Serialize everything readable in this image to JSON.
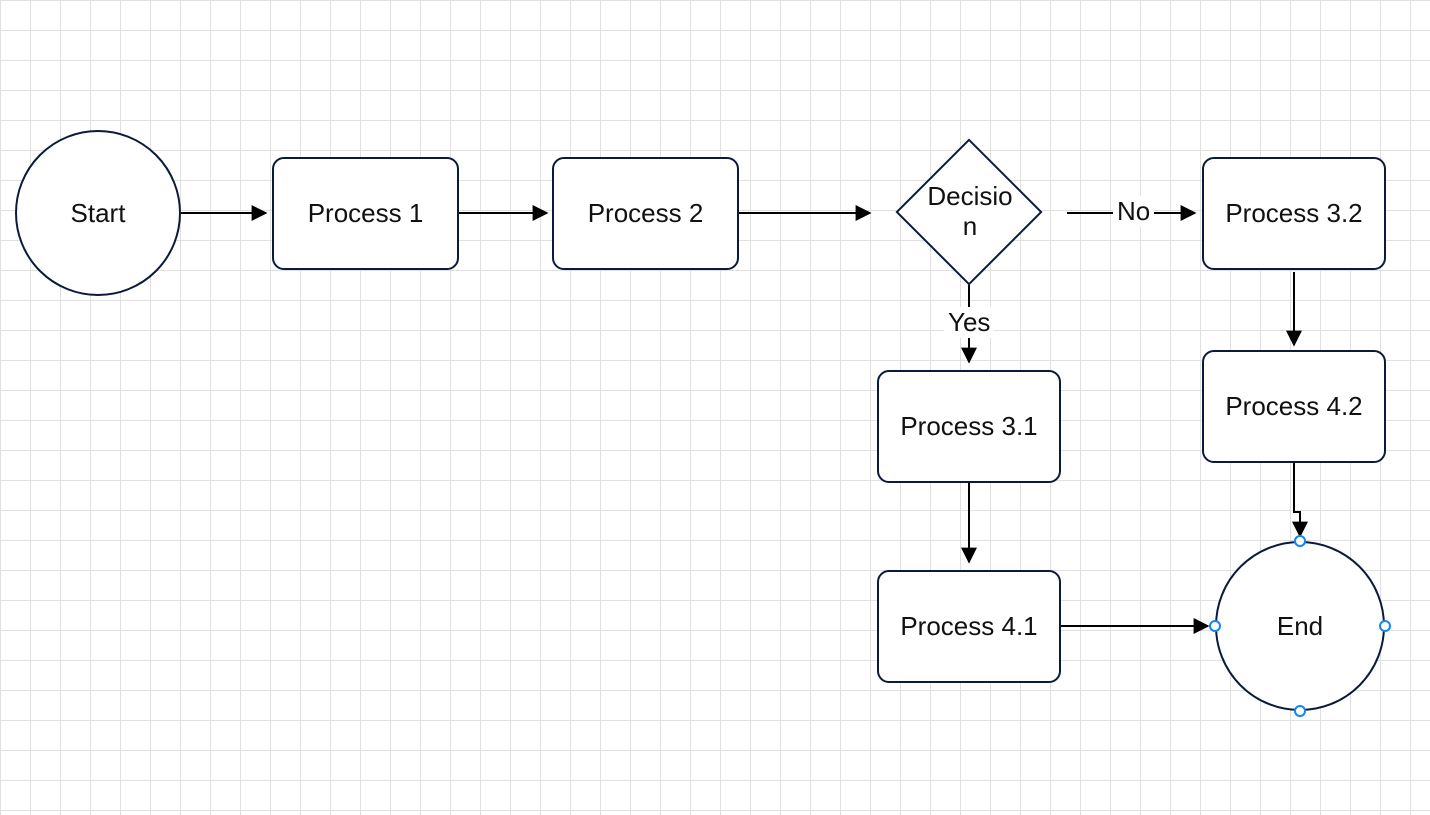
{
  "nodes": {
    "start": {
      "label": "Start"
    },
    "p1": {
      "label": "Process 1"
    },
    "p2": {
      "label": "Process 2"
    },
    "decision": {
      "label": "Decisio\nn"
    },
    "p31": {
      "label": "Process 3.1"
    },
    "p32": {
      "label": "Process 3.2"
    },
    "p41": {
      "label": "Process 4.1"
    },
    "p42": {
      "label": "Process 4.2"
    },
    "end": {
      "label": "End"
    }
  },
  "edge_labels": {
    "decision_no": "No",
    "decision_yes": "Yes"
  },
  "selected_node": "end",
  "colors": {
    "stroke": "#0b1a3a",
    "handle": "#1184ff",
    "grid": "#e0e0e0"
  }
}
